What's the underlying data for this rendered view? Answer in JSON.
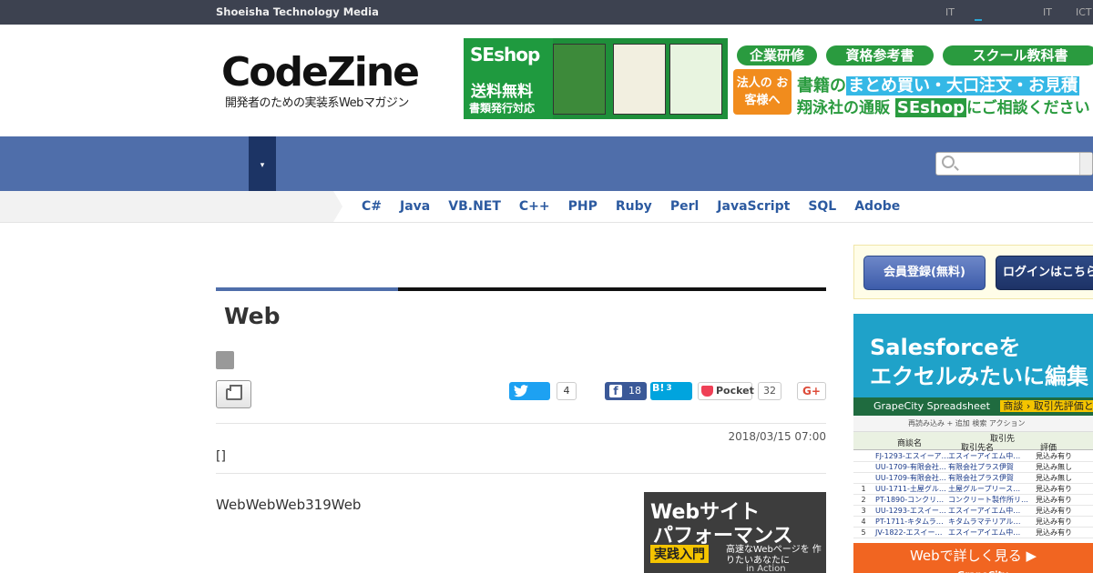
{
  "topbar": {
    "brand": "Shoeisha Technology Media",
    "links": [
      "IT",
      "IT",
      "ICT"
    ]
  },
  "logo": {
    "main": "CodeZine",
    "sub": "開発者のための実装系Webマガジン"
  },
  "banner": {
    "seshop": "SEshop",
    "free_shipping": "送料無料",
    "doc": "書類発行対応",
    "pills": [
      "企業研修",
      "資格参考書",
      "スクール教科書"
    ],
    "corp": "法人の お客様へ",
    "msg1_a": "書籍の",
    "msg1_hl": "まとめ買い・大口注文・お見積",
    "msg2_a": "翔泳社の通販",
    "msg2_big": "SEshop",
    "msg2_b": "にご相談ください"
  },
  "nav": {
    "dropdown": "▾"
  },
  "search": {
    "placeholder": ""
  },
  "langs": [
    "C#",
    "Java",
    "VB.NET",
    "C++",
    "PHP",
    "Ruby",
    "Perl",
    "JavaScript",
    "SQL",
    "Adobe"
  ],
  "article": {
    "title": "Web",
    "date": "2018/03/15 07:00",
    "bracket": "[]",
    "lead": "WebWebWeb319Web"
  },
  "share": {
    "twitter_count": "4",
    "facebook_count": "18",
    "hatena_label": "B!",
    "hatena_count": "3",
    "pocket_label": "Pocket",
    "pocket_count": "32",
    "gplus_label": "G+"
  },
  "book_ad": {
    "line1": "Webサイト",
    "line2": "パフォーマンス",
    "tag": "実践入門",
    "small": "高速なWebページを 作りたいあなたに",
    "series": "in Action"
  },
  "member": {
    "register": "会員登録(無料)",
    "login": "ログインはこちら"
  },
  "side_ad": {
    "h1": "Salesforceを",
    "h2": "エクセルみたいに編集",
    "app_title": "GrapeCity Spreadsheet",
    "crumbs": "商談 › 取引先評価と商談!",
    "toolbar": "再読み込み   + 追加  検索   アクション",
    "hdr_name": "商談名",
    "hdr_acc": "取引先",
    "hdr_acc_name": "取引先名",
    "hdr_rating": "評価",
    "rows": [
      {
        "num": "",
        "id": "FJ-1293-エスイーア…",
        "co": "エスイーアイエム中…",
        "st": "見込み有り"
      },
      {
        "num": "",
        "id": "UU-1709-有限会社…",
        "co": "有限会社プラス伊賀",
        "st": "見込み無し"
      },
      {
        "num": "",
        "id": "UU-1709-有限会社…",
        "co": "有限会社プラス伊賀",
        "st": "見込み無し"
      },
      {
        "num": "1",
        "id": "UU-1711-土屋グル…",
        "co": "土屋グループリース…",
        "st": "見込み有り"
      },
      {
        "num": "2",
        "id": "PT-1890-コンクリ…",
        "co": "コンクリート製作所リ…",
        "st": "見込み有り"
      },
      {
        "num": "3",
        "id": "UU-1293-エスイー…",
        "co": "エスイーアイエム中…",
        "st": "見込み有り"
      },
      {
        "num": "4",
        "id": "PT-1711-キタムラ…",
        "co": "キタムラマテリアル…",
        "st": "見込み有り"
      },
      {
        "num": "5",
        "id": "JV-1822-エスイー…",
        "co": "エスイーアイエム中…",
        "st": "見込み有り"
      }
    ],
    "cta": "Webで詳しく見る ▶",
    "brand": "GrapeCity"
  },
  "colors": {
    "nav": "#4f6eaa",
    "navdark": "#1c3465",
    "topbar": "#3d4250",
    "lang": "#2c5aa0"
  }
}
